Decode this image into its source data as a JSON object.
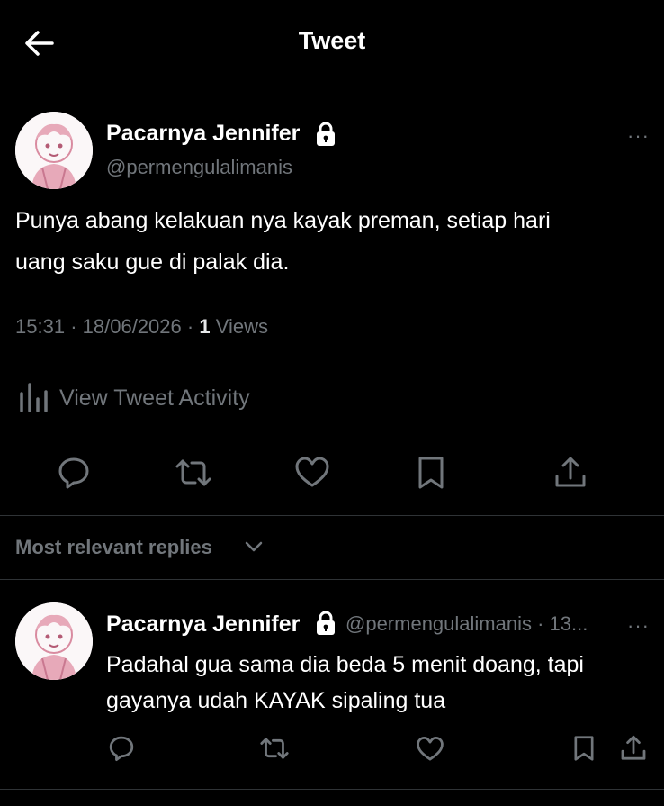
{
  "header": {
    "title": "Tweet",
    "back_icon": "arrow-left-icon"
  },
  "tweet": {
    "author_name": "Pacarnya Jennifer",
    "lock_icon": "lock-icon",
    "handle": "@permengulalimanis",
    "more": "···",
    "text_line1": "Punya abang kelakuan nya kayak preman, setiap hari",
    "text_line2": "uang saku gue di palak dia.",
    "time": "15:31",
    "date": "18/06/2026",
    "views_count": "1",
    "views_label": "Views",
    "activity_label": "View Tweet Activity",
    "actions": [
      "reply-icon",
      "retweet-icon",
      "like-icon",
      "bookmark-icon",
      "share-icon"
    ]
  },
  "replies_filter": {
    "label": "Most relevant replies"
  },
  "reply": {
    "author_name": "Pacarnya Jennifer",
    "handle_time": "@permengulalimanis · 13...",
    "more": "···",
    "text_line1": "Padahal gua sama dia beda 5 menit doang, tapi",
    "text_line2": "gayanya udah KAYAK sipaling tua"
  },
  "colors": {
    "background": "#000000",
    "text": "#e7e9ea",
    "muted": "#71767b",
    "divider": "#2f3336"
  }
}
